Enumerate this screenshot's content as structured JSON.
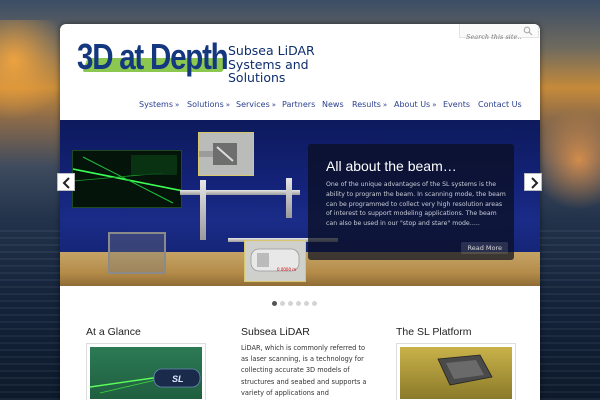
{
  "header": {
    "logo_text": "3D at Depth",
    "tagline": "Subsea LiDAR Systems and Solutions"
  },
  "search": {
    "placeholder": "Search this site..."
  },
  "nav": {
    "items": [
      {
        "label": "Systems",
        "has_submenu": true,
        "arrow": "»"
      },
      {
        "label": "Solutions",
        "has_submenu": true,
        "arrow": "»"
      },
      {
        "label": "Services",
        "has_submenu": true,
        "arrow": "»"
      },
      {
        "label": "Partners",
        "has_submenu": false,
        "arrow": ""
      },
      {
        "label": "News",
        "has_submenu": false,
        "arrow": ""
      },
      {
        "label": "Results",
        "has_submenu": true,
        "arrow": "»"
      },
      {
        "label": "About Us",
        "has_submenu": true,
        "arrow": "»"
      },
      {
        "label": "Events",
        "has_submenu": false,
        "arrow": ""
      },
      {
        "label": "Contact Us",
        "has_submenu": false,
        "arrow": ""
      }
    ]
  },
  "slider": {
    "title": "All about the beam…",
    "text": "One of the unique advantages of the SL systems is the ability to program the beam. In scanning mode, the beam can be programmed to collect very high resolution areas of interest to support modeling applications. The beam can also be used in our \"stop and stare\" mode…..",
    "read_more": "Read More",
    "inset_label": "0.0000 m",
    "slide_count": 6,
    "active_slide": 1
  },
  "columns": [
    {
      "title": "At a Glance",
      "text": ""
    },
    {
      "title": "Subsea LiDAR",
      "text": "LiDAR, which is commonly referred to as laser scanning, is a technology for collecting accurate 3D models of structures and seabed and supports a variety of applications and"
    },
    {
      "title": "The SL Platform",
      "text": ""
    }
  ],
  "colors": {
    "brand_blue": "#14387f",
    "brand_green": "#7fc23c",
    "nav_text": "#2a3f8f"
  }
}
